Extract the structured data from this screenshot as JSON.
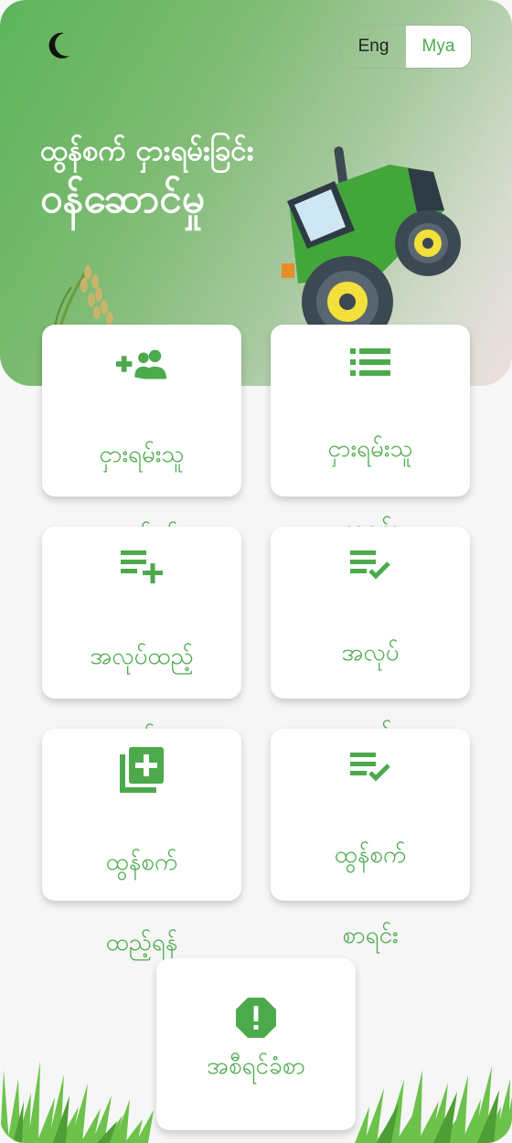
{
  "header": {
    "theme_icon": "moon-icon",
    "lang": {
      "eng": "Eng",
      "mya": "Mya",
      "active": "Mya"
    },
    "title_line1": "ထွန်စက် ငှားရမ်းခြင်း",
    "title_line2": "ဝန်ဆောင်မှု"
  },
  "menu": [
    {
      "id": "add-renter",
      "icon": "add-person-icon",
      "line1": "ငှားရမ်းသူ",
      "line2": "ထည့်ရန်"
    },
    {
      "id": "renter-list",
      "icon": "list-icon",
      "line1": "ငှားရမ်းသူ",
      "line2": "စာရင်း"
    },
    {
      "id": "add-job",
      "icon": "playlist-add-icon",
      "line1": "အလုပ်ထည့်",
      "line2": "ရန်"
    },
    {
      "id": "job-list",
      "icon": "playlist-check-icon",
      "line1": "အလုပ်",
      "line2": "စာရင်း"
    },
    {
      "id": "add-tractor",
      "icon": "library-add-icon",
      "line1": "ထွန်စက်",
      "line2": "ထည့်ရန်"
    },
    {
      "id": "tractor-list",
      "icon": "playlist-check-icon",
      "line1": "ထွန်စက်",
      "line2": "စာရင်း"
    }
  ],
  "report": {
    "icon": "alert-octagon-icon",
    "label": "အစီရင်ခံစာ"
  },
  "colors": {
    "accent": "#4caa4c",
    "hero_start": "#5cb45a",
    "hero_end": "#eedfe0"
  }
}
